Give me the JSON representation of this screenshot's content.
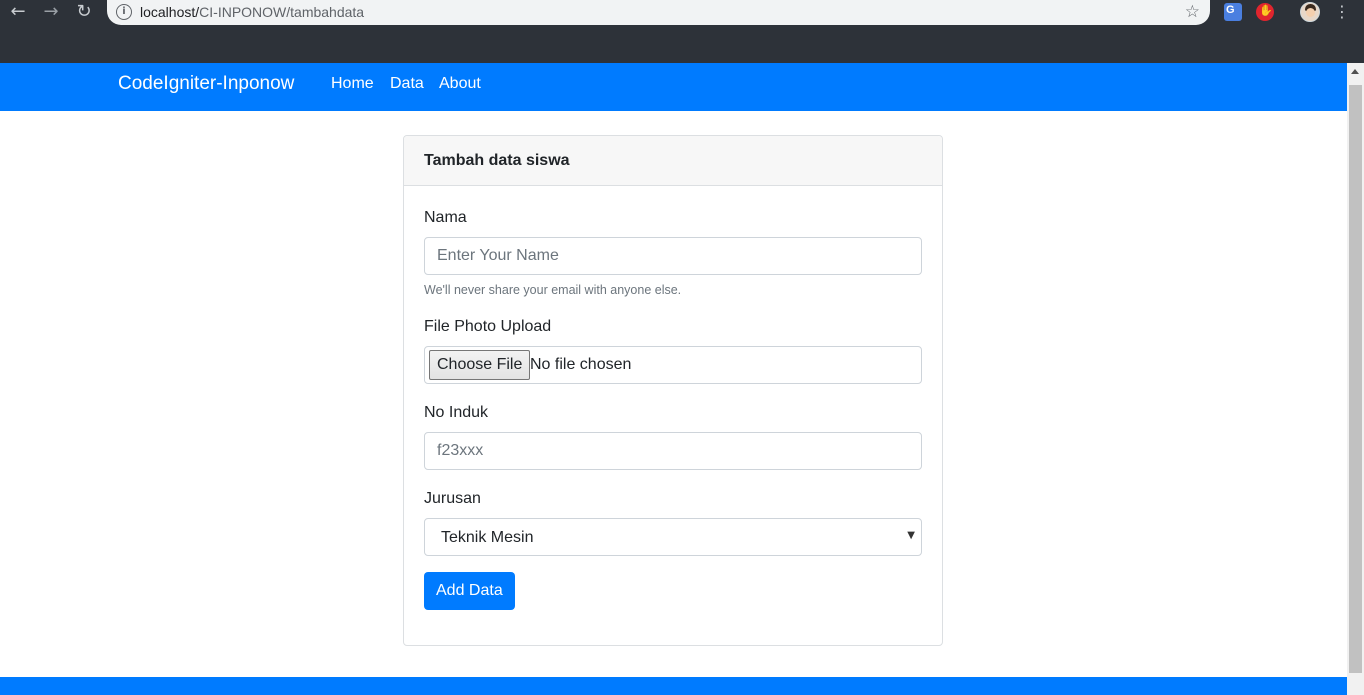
{
  "browser": {
    "back_icon": "←",
    "forward_icon": "→",
    "reload_icon": "↻",
    "info_icon": "i",
    "url_host": "localhost/",
    "url_path": "CI-INPONOW/tambahdata",
    "star_icon": "☆",
    "menu_icon": "⋮"
  },
  "navbar": {
    "brand": "CodeIgniter-Inponow",
    "links": [
      "Home",
      "Data",
      "About"
    ]
  },
  "card": {
    "title": "Tambah data siswa",
    "nama": {
      "label": "Nama",
      "placeholder": "Enter Your Name",
      "help": "We'll never share your email with anyone else."
    },
    "photo": {
      "label": "File Photo Upload",
      "button": "Choose File",
      "status": "No file chosen"
    },
    "no_induk": {
      "label": "No Induk",
      "placeholder": "f23xxx"
    },
    "jurusan": {
      "label": "Jurusan",
      "selected": "Teknik Mesin",
      "caret": "▼"
    },
    "submit": "Add Data"
  },
  "colors": {
    "primary": "#007bff",
    "chrome": "#2d3239"
  }
}
